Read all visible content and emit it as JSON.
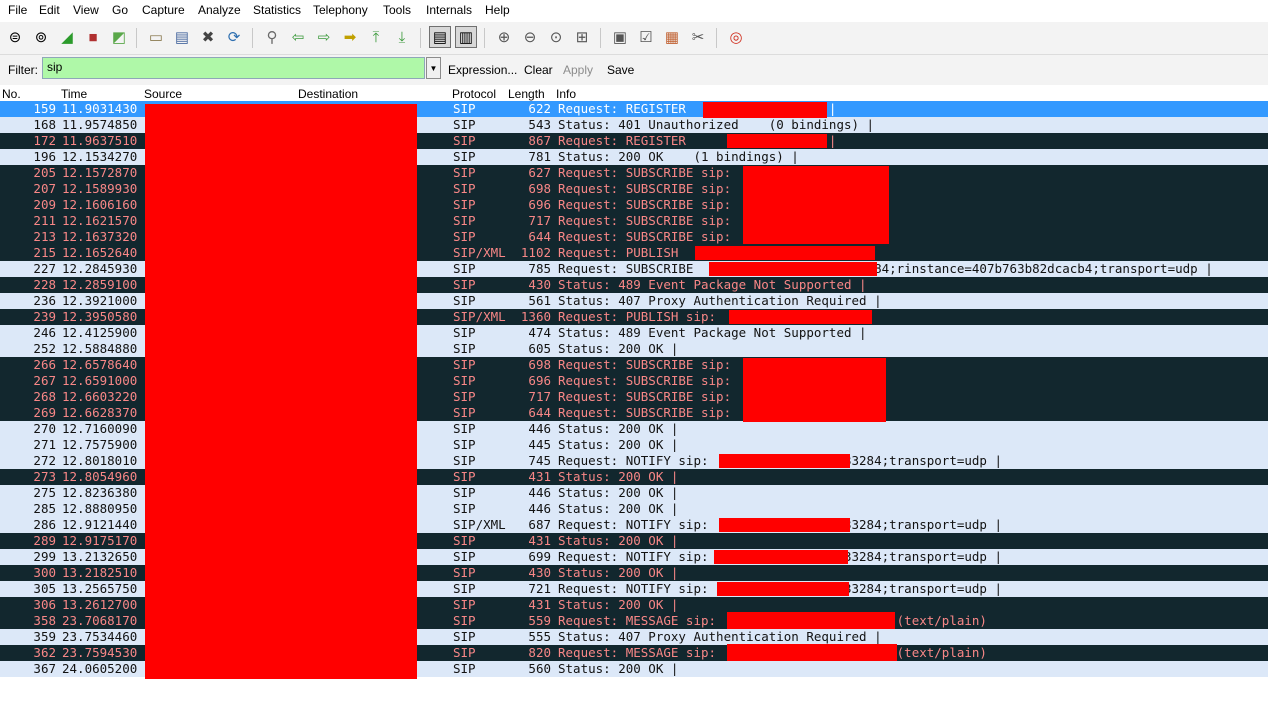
{
  "menu": [
    "File",
    "Edit",
    "View",
    "Go",
    "Capture",
    "Analyze",
    "Statistics",
    "Telephony",
    "Tools",
    "Internals",
    "Help"
  ],
  "toolbar_icons": [
    "interface-list-icon",
    "capture-options-icon",
    "start-capture-icon",
    "stop-capture-icon",
    "restart-capture-icon",
    "open-file-icon",
    "save-file-icon",
    "close-file-icon",
    "reload-icon",
    "find-packet-icon",
    "go-back-icon",
    "go-forward-icon",
    "go-to-packet-icon",
    "go-first-icon",
    "go-last-icon",
    "colorize-icon",
    "auto-scroll-icon",
    "zoom-in-icon",
    "zoom-out-icon",
    "normal-size-icon",
    "resize-columns-icon",
    "capture-filters-icon",
    "display-filters-icon",
    "coloring-rules-icon",
    "preferences-icon",
    "help-icon"
  ],
  "filter": {
    "label": "Filter:",
    "value": "sip",
    "expression": "Expression...",
    "clear": "Clear",
    "apply": "Apply",
    "save": "Save",
    "bg_color": "#aff8a8"
  },
  "columns": {
    "no": "No.",
    "time": "Time",
    "source": "Source",
    "destination": "Destination",
    "protocol": "Protocol",
    "length": "Length",
    "info": "Info"
  },
  "colors": {
    "selected": "#3399ff",
    "light": "#dce8f8",
    "dark": "#12272e",
    "dark_text": "#f88787",
    "redaction": "#ff0000"
  },
  "packets": [
    {
      "no": "159",
      "time": "11.9031430",
      "proto": "SIP",
      "len": "622",
      "info": "Request: REGISTER                   |",
      "style": "selected"
    },
    {
      "no": "168",
      "time": "11.9574850",
      "proto": "SIP",
      "len": "543",
      "info": "Status: 401 Unauthorized    (0 bindings) |",
      "style": "light"
    },
    {
      "no": "172",
      "time": "11.9637510",
      "proto": "SIP",
      "len": "867",
      "info": "Request: REGISTER                   |",
      "style": "dark"
    },
    {
      "no": "196",
      "time": "12.1534270",
      "proto": "SIP",
      "len": "781",
      "info": "Status: 200 OK    (1 bindings) |",
      "style": "light"
    },
    {
      "no": "205",
      "time": "12.1572870",
      "proto": "SIP",
      "len": "627",
      "info": "Request: SUBSCRIBE sip:                   |",
      "style": "dark"
    },
    {
      "no": "207",
      "time": "12.1589930",
      "proto": "SIP",
      "len": "698",
      "info": "Request: SUBSCRIBE sip:                   |",
      "style": "dark"
    },
    {
      "no": "209",
      "time": "12.1606160",
      "proto": "SIP",
      "len": "696",
      "info": "Request: SUBSCRIBE sip:                   |",
      "style": "dark"
    },
    {
      "no": "211",
      "time": "12.1621570",
      "proto": "SIP",
      "len": "717",
      "info": "Request: SUBSCRIBE sip:                   |",
      "style": "dark"
    },
    {
      "no": "213",
      "time": "12.1637320",
      "proto": "SIP",
      "len": "644",
      "info": "Request: SUBSCRIBE sip:                   |",
      "style": "dark"
    },
    {
      "no": "215",
      "time": "12.1652640",
      "proto": "SIP/XML",
      "len": "1102",
      "info": "Request: PUBLISH                       |",
      "style": "dark"
    },
    {
      "no": "227",
      "time": "12.2845930",
      "proto": "SIP",
      "len": "785",
      "info": "Request: SUBSCRIBE                     33284;rinstance=407b763b82dcacb4;transport=udp |",
      "style": "light"
    },
    {
      "no": "228",
      "time": "12.2859100",
      "proto": "SIP",
      "len": "430",
      "info": "Status: 489 Event Package Not Supported |",
      "style": "dark"
    },
    {
      "no": "236",
      "time": "12.3921000",
      "proto": "SIP",
      "len": "561",
      "info": "Status: 407 Proxy Authentication Required |",
      "style": "light"
    },
    {
      "no": "239",
      "time": "12.3950580",
      "proto": "SIP/XML",
      "len": "1360",
      "info": "Request: PUBLISH sip:                  |",
      "style": "dark"
    },
    {
      "no": "246",
      "time": "12.4125900",
      "proto": "SIP",
      "len": "474",
      "info": "Status: 489 Event Package Not Supported |",
      "style": "light"
    },
    {
      "no": "252",
      "time": "12.5884880",
      "proto": "SIP",
      "len": "605",
      "info": "Status: 200 OK |",
      "style": "light"
    },
    {
      "no": "266",
      "time": "12.6578640",
      "proto": "SIP",
      "len": "698",
      "info": "Request: SUBSCRIBE sip:                   |",
      "style": "dark"
    },
    {
      "no": "267",
      "time": "12.6591000",
      "proto": "SIP",
      "len": "696",
      "info": "Request: SUBSCRIBE sip:                   |",
      "style": "dark"
    },
    {
      "no": "268",
      "time": "12.6603220",
      "proto": "SIP",
      "len": "717",
      "info": "Request: SUBSCRIBE sip:                   |",
      "style": "dark"
    },
    {
      "no": "269",
      "time": "12.6628370",
      "proto": "SIP",
      "len": "644",
      "info": "Request: SUBSCRIBE sip:                   |",
      "style": "dark"
    },
    {
      "no": "270",
      "time": "12.7160090",
      "proto": "SIP",
      "len": "446",
      "info": "Status: 200 OK |",
      "style": "light"
    },
    {
      "no": "271",
      "time": "12.7575900",
      "proto": "SIP",
      "len": "445",
      "info": "Status: 200 OK |",
      "style": "light"
    },
    {
      "no": "272",
      "time": "12.8018010",
      "proto": "SIP",
      "len": "745",
      "info": "Request: NOTIFY sip:                 :33284;transport=udp |",
      "style": "light"
    },
    {
      "no": "273",
      "time": "12.8054960",
      "proto": "SIP",
      "len": "431",
      "info": "Status: 200 OK |",
      "style": "dark"
    },
    {
      "no": "275",
      "time": "12.8236380",
      "proto": "SIP",
      "len": "446",
      "info": "Status: 200 OK |",
      "style": "light"
    },
    {
      "no": "285",
      "time": "12.8880950",
      "proto": "SIP",
      "len": "446",
      "info": "Status: 200 OK |",
      "style": "light"
    },
    {
      "no": "286",
      "time": "12.9121440",
      "proto": "SIP/XML",
      "len": "687",
      "info": "Request: NOTIFY sip:                 :33284;transport=udp |",
      "style": "light"
    },
    {
      "no": "289",
      "time": "12.9175170",
      "proto": "SIP",
      "len": "431",
      "info": "Status: 200 OK |",
      "style": "dark"
    },
    {
      "no": "299",
      "time": "13.2132650",
      "proto": "SIP",
      "len": "699",
      "info": "Request: NOTIFY sip:                 :33284;transport=udp |",
      "style": "light"
    },
    {
      "no": "300",
      "time": "13.2182510",
      "proto": "SIP",
      "len": "430",
      "info": "Status: 200 OK |",
      "style": "dark"
    },
    {
      "no": "305",
      "time": "13.2565750",
      "proto": "SIP",
      "len": "721",
      "info": "Request: NOTIFY sip:                 :33284;transport=udp |",
      "style": "light"
    },
    {
      "no": "306",
      "time": "13.2612700",
      "proto": "SIP",
      "len": "431",
      "info": "Status: 200 OK |",
      "style": "dark"
    },
    {
      "no": "358",
      "time": "23.7068170",
      "proto": "SIP",
      "len": "559",
      "info": "Request: MESSAGE sip:                     |  (text/plain)",
      "style": "dark"
    },
    {
      "no": "359",
      "time": "23.7534460",
      "proto": "SIP",
      "len": "555",
      "info": "Status: 407 Proxy Authentication Required |",
      "style": "light"
    },
    {
      "no": "362",
      "time": "23.7594530",
      "proto": "SIP",
      "len": "820",
      "info": "Request: MESSAGE sip:                     |  (text/plain)",
      "style": "dark"
    },
    {
      "no": "367",
      "time": "24.0605200",
      "proto": "SIP",
      "len": "560",
      "info": "Status: 200 OK |",
      "style": "light"
    }
  ]
}
